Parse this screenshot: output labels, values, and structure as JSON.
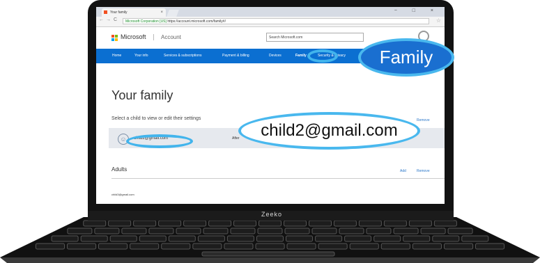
{
  "browser": {
    "tab_title": "Your family",
    "tab_close": "×",
    "window_controls": "− □ ×",
    "nav_back": "←",
    "nav_forward": "→",
    "nav_reload": "C",
    "url_secure_label": "Microsoft Corporation [US]",
    "url": "https://account.microsoft.com/family#/",
    "star": "☆"
  },
  "header": {
    "brand": "Microsoft",
    "section": "Account",
    "search_placeholder": "Search Microsoft.com"
  },
  "nav": {
    "items": [
      "Home",
      "Your info",
      "Services & subscriptions",
      "Payment & billing",
      "Devices",
      "Family",
      "Security & privacy"
    ]
  },
  "page": {
    "title": "Your family",
    "select_prompt": "Select a child to view or edit their settings",
    "remove_label": "Remove",
    "child_email": "child2@gmail.com",
    "child_status": "After",
    "adults_heading": "Adults",
    "add_label": "Add",
    "adult_email": "child3@gmail.com"
  },
  "callouts": {
    "family": "Family",
    "child_email": "child2@gmail.com"
  },
  "laptop": {
    "brand": "Zeeko"
  },
  "colors": {
    "accent_blue": "#0b6fd1",
    "callout_ring": "#42b4ec",
    "link": "#2a77c9"
  }
}
